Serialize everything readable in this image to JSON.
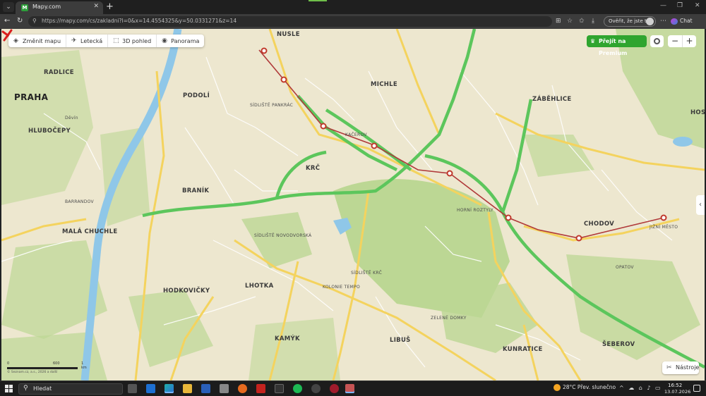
{
  "browser": {
    "tab_title": "Mapy.com",
    "url": "https://mapy.com/cs/zakladni?l=0&x=14.4554325&y=50.0331271&z=14",
    "login_label": "Ověřit, že jste to vy",
    "chat_label": "Chat"
  },
  "map_toolbar": {
    "change_map": "Změnit mapu",
    "aerial": "Letecká",
    "view_3d": "3D pohled",
    "panorama": "Panorama"
  },
  "premium_label": "Přejít na Premium",
  "tools_label": "Nástroje",
  "scale": {
    "l0": "0",
    "l1": "600",
    "l2": "1 km"
  },
  "copyright": "© Seznam.cz, a.s., 2026 a další",
  "places": {
    "praha": "PRAHA",
    "radlice": "RADLICE",
    "hlubocepy": "HLUBOČEPY",
    "podoli": "PODOLÍ",
    "branik": "BRANÍK",
    "krc": "KRČ",
    "michle": "MICHLE",
    "zabehlice": "ZÁBĚHLICE",
    "chodov": "CHODOV",
    "hostivar": "HOST",
    "mala_chuchle": "MALÁ CHUCHLE",
    "hodkovicky": "HODKOVIČKY",
    "lhotka": "LHOTKA",
    "kamyk": "KAMÝK",
    "libus": "LIBUŠ",
    "kunratice": "KUNRATICE",
    "seberov": "ŠEBEROV",
    "nusle": "NUSLE",
    "hornirostyly": "HORNÍ ROZTYLY",
    "sidliste_novodvorska": "SÍDLIŠTĚ NOVODVORSKÁ",
    "kolonie_tempo": "KOLONIE TEMPO",
    "sidliste_krc": "SÍDLIŠTĚ KRČ",
    "sidliste_pankrac": "SÍDLIŠTĚ PANKRÁC",
    "kacerov": "KAČEROV",
    "devin": "Děvín",
    "barrandov": "BARRANDOV",
    "zelene_domky": "ZELENÉ DOMKY",
    "opatov": "OPATOV",
    "jizni_mesto": "JIŽNÍ MĚSTO"
  },
  "taskbar": {
    "search": "Hledat",
    "weather": "28°C  Přev. slunečno",
    "time": "16:52",
    "date": "13.07.2026"
  },
  "colors": {
    "land": "#ede7cf",
    "forest": "#b8d48f",
    "highway": "#5cc65c",
    "main_road": "#f4d35e",
    "metro": "#c0392b",
    "river": "#8fc7e8",
    "premium": "#2fa52f"
  },
  "icons": {
    "layers": "layers-icon",
    "plane": "plane-icon",
    "cube": "cube-icon",
    "eye": "eye-icon",
    "tools": "ruler-icon"
  }
}
